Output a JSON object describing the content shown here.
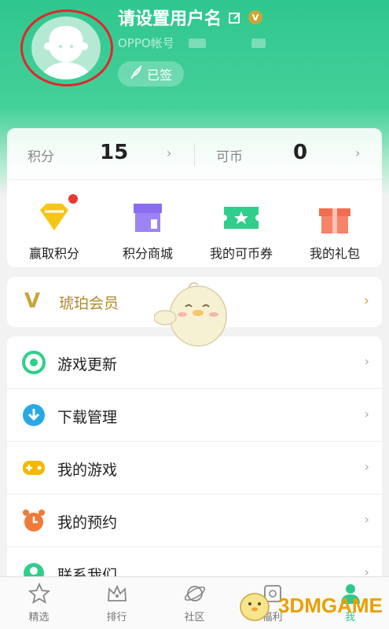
{
  "profile": {
    "username": "请设置用户名",
    "vip_badge": "V",
    "account_label": "OPPO帐号",
    "signed_label": "已签"
  },
  "points": {
    "points_label": "积分",
    "points_value": "15",
    "coins_label": "可币",
    "coins_value": "0",
    "arrow": "›"
  },
  "quick_actions": [
    {
      "label": "赢取积分",
      "icon": "diamond-icon",
      "color": "#f5c518",
      "has_badge": true
    },
    {
      "label": "积分商城",
      "icon": "shop-icon",
      "color": "#8a6cf0"
    },
    {
      "label": "我的可币券",
      "icon": "ticket-icon",
      "color": "#2ecf8a"
    },
    {
      "label": "我的礼包",
      "icon": "gift-icon",
      "color": "#f26d4f"
    }
  ],
  "amber": {
    "v": "V",
    "label": "琥珀会员",
    "arrow": "›"
  },
  "list": [
    {
      "label": "游戏更新",
      "icon": "update-icon",
      "color": "#2ecf8a"
    },
    {
      "label": "下载管理",
      "icon": "download-icon",
      "color": "#29a8e6"
    },
    {
      "label": "我的游戏",
      "icon": "gamepad-icon",
      "color": "#f5b800"
    },
    {
      "label": "我的预约",
      "icon": "alarm-icon",
      "color": "#f07a3a"
    },
    {
      "label": "联系我们",
      "icon": "contact-icon",
      "color": "#2ecf8a"
    }
  ],
  "list_arrow": "›",
  "tabs": [
    {
      "label": "精选",
      "icon": "star-icon"
    },
    {
      "label": "排行",
      "icon": "crown-icon"
    },
    {
      "label": "社区",
      "icon": "planet-icon"
    },
    {
      "label": "福利",
      "icon": "gift-box-icon"
    },
    {
      "label": "我",
      "icon": "person-icon",
      "active": true
    }
  ],
  "watermark": "3DMGAME",
  "colors": {
    "brand_green": "#2fc78e",
    "amber_gold": "#c9a63a",
    "badge_red": "#e53935"
  }
}
